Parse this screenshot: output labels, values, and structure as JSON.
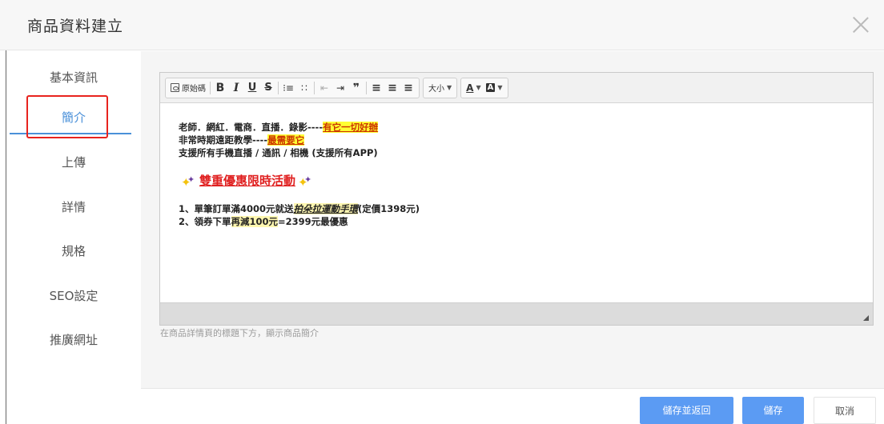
{
  "modal": {
    "title": "商品資料建立"
  },
  "sidebar": {
    "items": [
      {
        "label": "基本資訊",
        "active": false
      },
      {
        "label": "簡介",
        "active": true
      },
      {
        "label": "上傳",
        "active": false
      },
      {
        "label": "詳情",
        "active": false
      },
      {
        "label": "規格",
        "active": false
      },
      {
        "label": "SEO設定",
        "active": false
      },
      {
        "label": "推廣網址",
        "active": false
      }
    ]
  },
  "toolbar": {
    "source_label": "原始碼",
    "bold": "B",
    "italic": "I",
    "underline": "U",
    "strike": "S",
    "ordered_list": "⁝≡",
    "unordered_list": "∷",
    "outdent": "⇤",
    "indent": "⇥",
    "blockquote": "❞",
    "align_left": "≡",
    "align_center": "≡",
    "align_right": "≡",
    "font_size_label": "大小",
    "font_color": "A",
    "bg_color": "A"
  },
  "content": {
    "line1_prefix": "老師．網紅．電商．直播．錄影----",
    "line1_highlight": "有它一切好辦",
    "line2_prefix": "非常時期遠距教學----",
    "line2_highlight": "最需要它",
    "line3": "支援所有手機直播 / 通訊 / 相機 (支援所有APP)",
    "promo": "雙重優惠限時活動",
    "item1_prefix": "1、單筆訂單滿4000元就送",
    "item1_emph": "拍朵拉運動手環",
    "item1_suffix": "(定價1398元)",
    "item2_prefix": "2、領券下單",
    "item2_highlight": "再減100元",
    "item2_suffix": "=2399元最優惠"
  },
  "help_text": "在商品詳情頁的標題下方，顯示商品簡介",
  "footer": {
    "save_return_label": "儲存並返回",
    "save_label": "儲存",
    "cancel_label": "取消"
  },
  "colors": {
    "accent": "#5b9bf3",
    "active_tab": "#4a90d9",
    "highlight_box": "#e8231e",
    "text_highlight": "#ffff33",
    "promo_red": "#e02020"
  }
}
